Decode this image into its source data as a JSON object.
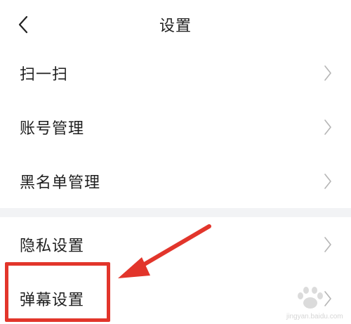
{
  "header": {
    "title": "设置",
    "back_icon": "chevron-left-icon"
  },
  "menu": {
    "items": [
      {
        "label": "扫一扫"
      },
      {
        "label": "账号管理"
      },
      {
        "label": "黑名单管理"
      },
      {
        "label": "隐私设置"
      },
      {
        "label": "弹幕设置"
      }
    ],
    "arrow_icon": "chevron-right-icon"
  },
  "annotation": {
    "color": "#e2352b"
  },
  "watermark": {
    "text": "jingyan.baidu.com"
  },
  "colors": {
    "background": "#ffffff",
    "section_gap": "#f2f3f5",
    "text": "#1f1f1f",
    "arrow": "#b5b5b5"
  }
}
